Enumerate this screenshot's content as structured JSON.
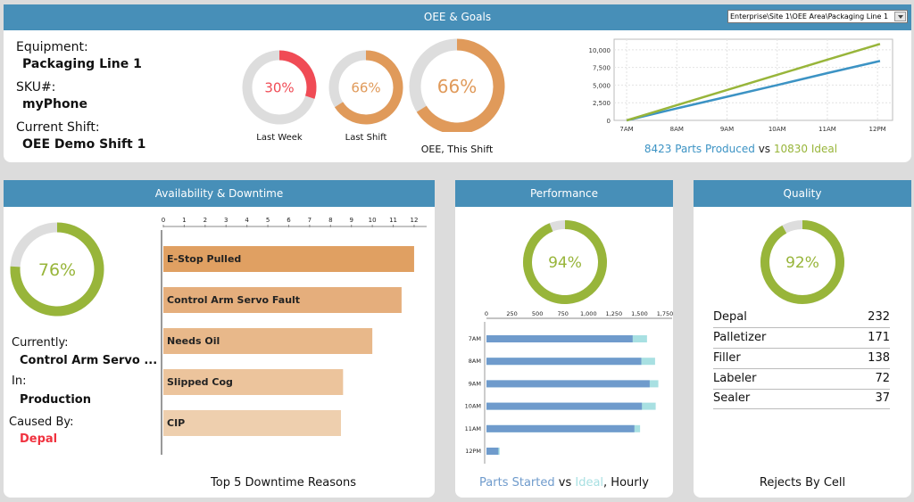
{
  "header": {
    "title": "OEE & Goals",
    "location_select": {
      "value": "Enterprise\\Site 1\\OEE Area\\Packaging Line 1"
    }
  },
  "info": {
    "equipment_label": "Equipment:",
    "equipment_value": "Packaging Line 1",
    "sku_label": "SKU#:",
    "sku_value": "myPhone",
    "shift_label": "Current Shift:",
    "shift_value": "OEE Demo Shift 1"
  },
  "oee_gauges": [
    {
      "id": "last-week",
      "value": 30,
      "text": "30%",
      "caption": "Last Week",
      "color": "#f04b55"
    },
    {
      "id": "last-shift",
      "value": 66,
      "text": "66%",
      "caption": "Last Shift",
      "color": "#e09a5a"
    },
    {
      "id": "this-shift",
      "value": 66,
      "text": "66%",
      "caption": "OEE, This Shift",
      "color": "#e09a5a"
    }
  ],
  "colors": {
    "header_blue": "#478fb8",
    "produced_blue": "#3c93c4",
    "ideal_green": "#98b53a",
    "gauge_track": "#dddddd",
    "started_blue": "#6f9bcc",
    "ideal_cyan": "#a8e0e2",
    "alert_red": "#f0323f"
  },
  "production_summary": {
    "produced_text": "8423 Parts Produced",
    "vs": "vs",
    "ideal_text": "10830 Ideal"
  },
  "availability": {
    "title": "Availability & Downtime",
    "gauge": {
      "value": 76,
      "text": "76%",
      "color": "#98b53a"
    },
    "currently_label": "Currently:",
    "currently_value": "Control Arm Servo ...",
    "in_label": "In:",
    "in_value": "Production",
    "caused_label": "Caused By:",
    "caused_value": "Depal",
    "chart_caption": "Top 5 Downtime Reasons"
  },
  "performance": {
    "title": "Performance",
    "gauge": {
      "value": 94,
      "text": "94%",
      "color": "#98b53a"
    },
    "caption_started": "Parts Started",
    "caption_vs": "vs",
    "caption_ideal": "Ideal",
    "caption_rest": ", Hourly"
  },
  "quality": {
    "title": "Quality",
    "gauge": {
      "value": 92,
      "text": "92%",
      "color": "#98b53a"
    },
    "rejects": [
      {
        "cell": "Depal",
        "count": "232"
      },
      {
        "cell": "Palletizer",
        "count": "171"
      },
      {
        "cell": "Filler",
        "count": "138"
      },
      {
        "cell": "Labeler",
        "count": "72"
      },
      {
        "cell": "Sealer",
        "count": "37"
      }
    ],
    "caption": "Rejects By Cell"
  },
  "chart_data": [
    {
      "type": "line",
      "title": "",
      "xlabel": "",
      "ylabel": "",
      "x_ticks": [
        "7AM",
        "8AM",
        "9AM",
        "10AM",
        "11AM",
        "12PM"
      ],
      "y_ticks": [
        "0",
        "2,500",
        "5,000",
        "7,500",
        "10,000"
      ],
      "xlim_hours": [
        6.75,
        12.3
      ],
      "ylim": [
        0,
        11500
      ],
      "grid": true,
      "series": [
        {
          "name": "Parts Produced",
          "color": "#3c93c4",
          "x": [
            7.0,
            8.0,
            9.0,
            10.0,
            11.0,
            12.05
          ],
          "y": [
            0,
            1700,
            3350,
            5000,
            6700,
            8423
          ]
        },
        {
          "name": "Ideal",
          "color": "#98b53a",
          "x": [
            7.0,
            8.0,
            9.0,
            10.0,
            11.0,
            12.05
          ],
          "y": [
            0,
            2150,
            4300,
            6450,
            8600,
            10830
          ]
        }
      ]
    },
    {
      "type": "bar",
      "orientation": "horizontal",
      "title": "Top 5 Downtime Reasons",
      "categories": [
        "E-Stop Pulled",
        "Control Arm Servo Fault",
        "Needs Oil",
        "Slipped Cog",
        "CIP"
      ],
      "values": [
        12.0,
        11.4,
        10.0,
        8.6,
        8.5
      ],
      "colors": [
        "#e0a062",
        "#e5ae7c",
        "#e8b88a",
        "#ecc49c",
        "#eecfae"
      ],
      "x_ticks": [
        "0",
        "1",
        "2",
        "3",
        "4",
        "5",
        "6",
        "7",
        "8",
        "9",
        "10",
        "11",
        "12"
      ],
      "xlim": [
        0,
        12.6
      ]
    },
    {
      "type": "bar",
      "orientation": "horizontal",
      "title": "Parts Started vs Ideal, Hourly",
      "categories": [
        "7AM",
        "8AM",
        "9AM",
        "10AM",
        "11AM",
        "12PM"
      ],
      "series": [
        {
          "name": "Parts Started",
          "color": "#6f9bcc",
          "values": [
            1433,
            1518,
            1600,
            1524,
            1450,
            117
          ]
        },
        {
          "name": "Ideal",
          "color": "#a8e0e2",
          "values": [
            1574,
            1653,
            1685,
            1659,
            1506,
            129
          ]
        }
      ],
      "x_ticks": [
        "0",
        "250",
        "500",
        "750",
        "1,000",
        "1,250",
        "1,500",
        "1,750"
      ],
      "xlim": [
        0,
        1800
      ]
    }
  ]
}
